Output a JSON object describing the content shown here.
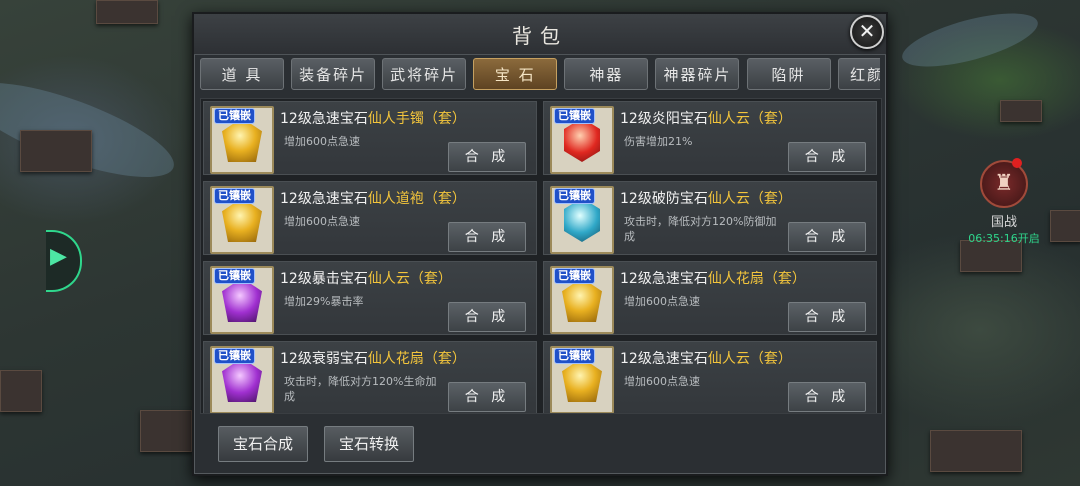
{
  "title": "背包",
  "tabs": [
    "道 具",
    "装备碎片",
    "武将碎片",
    "宝 石",
    "神器",
    "神器碎片",
    "陷阱",
    "红颜碎"
  ],
  "active_tab": "宝 石",
  "inlay_tag": "已镶嵌",
  "merge_label": "合 成",
  "items": [
    {
      "prefix": "12级急速宝石",
      "suffix": "仙人手镯（套）",
      "desc": "增加600点急速",
      "gem_color": "gold"
    },
    {
      "prefix": "12级炎阳宝石",
      "suffix": "仙人云（套）",
      "desc": "伤害增加21%",
      "gem_color": "red"
    },
    {
      "prefix": "12级急速宝石",
      "suffix": "仙人道袍（套）",
      "desc": "增加600点急速",
      "gem_color": "gold"
    },
    {
      "prefix": "12级破防宝石",
      "suffix": "仙人云（套）",
      "desc": "攻击时，降低对方120%防御加成",
      "gem_color": "cyan"
    },
    {
      "prefix": "12级暴击宝石",
      "suffix": "仙人云（套）",
      "desc": "增加29%暴击率",
      "gem_color": "purple"
    },
    {
      "prefix": "12级急速宝石",
      "suffix": "仙人花扇（套）",
      "desc": "增加600点急速",
      "gem_color": "gold"
    },
    {
      "prefix": "12级衰弱宝石",
      "suffix": "仙人花扇（套）",
      "desc": "攻击时，降低对方120%生命加成",
      "gem_color": "purple"
    },
    {
      "prefix": "12级急速宝石",
      "suffix": "仙人云（套）",
      "desc": "增加600点急速",
      "gem_color": "gold"
    }
  ],
  "bottom_buttons": {
    "gem_merge": "宝石合成",
    "gem_convert": "宝石转换"
  },
  "map": {
    "guozhan_label": "国战",
    "guozhan_timer": "06:35:16开启",
    "side_tab_icon": "expand-icon"
  }
}
